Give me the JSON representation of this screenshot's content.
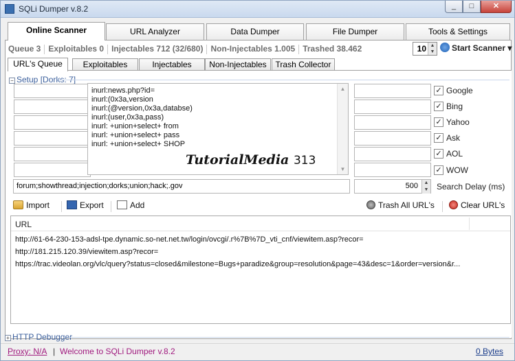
{
  "window": {
    "title": "SQLi Dumper v.8.2",
    "minimize": "_",
    "maximize": "□",
    "close": "✕"
  },
  "main_tabs": [
    "Online Scanner",
    "URL Analyzer",
    "Data Dumper",
    "File Dumper",
    "Tools & Settings"
  ],
  "stats": {
    "queue": "Queue 3",
    "exploitables": "Exploitables 0",
    "injectables": "Injectables 712 (32/680)",
    "non_injectables": "Non-Injectables 1.005",
    "trashed": "Trashed 38.462"
  },
  "threads": {
    "value": "10"
  },
  "start_scanner": {
    "label": "Start Scanner",
    "arrow": "▾"
  },
  "sub_tabs": [
    "URL's Queue",
    "Exploitables",
    "Injectables",
    "Non-Injectables",
    "Trash Collector"
  ],
  "setup": {
    "label": "Setup [Dorks: 7]",
    "toggle": "−"
  },
  "dorks": [
    "inurl:news.php?id=",
    "inurl:(0x3a,version",
    "inurl:(@version,0x3a,databse)",
    "inurl:(user,0x3a,pass)",
    "inurl: +union+select+ from",
    "inurl: +union+select+ pass",
    "inurl: +union+select+ SHOP"
  ],
  "watermark": {
    "text": "TutorialMedia",
    "number": "313"
  },
  "search_engines": [
    {
      "label": "Google",
      "checked": true
    },
    {
      "label": "Bing",
      "checked": true
    },
    {
      "label": "Yahoo",
      "checked": true
    },
    {
      "label": "Ask",
      "checked": true
    },
    {
      "label": "AOL",
      "checked": true
    },
    {
      "label": "WOW",
      "checked": true
    }
  ],
  "filter": {
    "value": "forum;showthread;injection;dorks;union;hack;.gov"
  },
  "search_delay": {
    "value": "500",
    "label": "Search Delay (ms)"
  },
  "toolbar": {
    "import": "Import",
    "export": "Export",
    "add": "Add",
    "trash_all": "Trash All URL's",
    "clear": "Clear URL's"
  },
  "grid": {
    "header": "URL",
    "rows": [
      "http://61-64-230-153-adsl-tpe.dynamic.so-net.net.tw/login/ovcgi/.r%7B%7D_vti_cnf/viewitem.asp?recor=",
      "http://181.215.120.39/viewitem.asp?recor=",
      "https://trac.videolan.org/vlc/query?status=closed&milestone=Bugs+paradize&group=resolution&page=43&desc=1&order=version&r..."
    ]
  },
  "http_debugger": {
    "label": "HTTP Debugger",
    "toggle": "+"
  },
  "status": {
    "proxy": "Proxy: N/A",
    "separator": "|",
    "welcome": "Welcome to SQLi Dumper v.8.2",
    "bytes": "0 Bytes"
  },
  "colors": {
    "accent": "#3b5f9c",
    "status_text": "#a0197e",
    "link": "#1a3c8a"
  },
  "icons": [
    "app-icon",
    "folder-icon",
    "save-icon",
    "add-icon",
    "trash-icon",
    "clear-icon",
    "start-icon"
  ]
}
